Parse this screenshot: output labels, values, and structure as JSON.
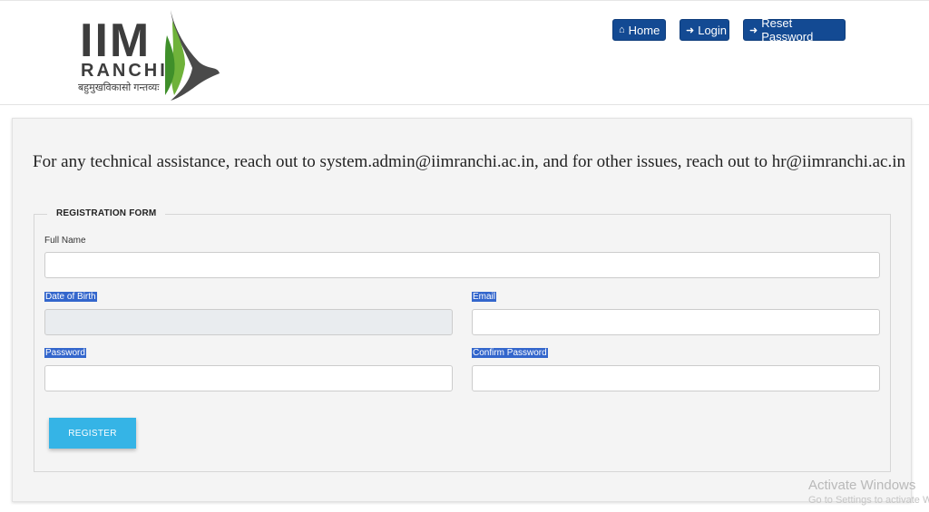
{
  "header": {
    "logo": {
      "iim": "IIM",
      "ranchi": "RANCHI",
      "motto": "बहुमुखविकासो गन्तव्यः"
    },
    "nav": [
      {
        "icon": "home-icon",
        "label": "Home"
      },
      {
        "icon": "sign-in-icon",
        "label": "Login"
      },
      {
        "icon": "sign-in-icon",
        "label": "Reset Password"
      }
    ],
    "nav_color": "#134a93"
  },
  "notice": "For any technical assistance, reach out to system.admin@iimranchi.ac.in, and for other issues, reach out to hr@iimranchi.ac.in",
  "form": {
    "legend": "REGISTRATION FORM",
    "full_name": {
      "label": "Full Name",
      "value": ""
    },
    "dob": {
      "label": "Date of Birth",
      "value": ""
    },
    "email": {
      "label": "Email",
      "value": ""
    },
    "password": {
      "label": "Password",
      "value": ""
    },
    "confirm_password": {
      "label": "Confirm Password",
      "value": ""
    },
    "register_label": "REGISTER",
    "register_color": "#35b4e6"
  },
  "watermark": {
    "line1": "Activate Windows",
    "line2": "Go to Settings to activate Windows."
  }
}
